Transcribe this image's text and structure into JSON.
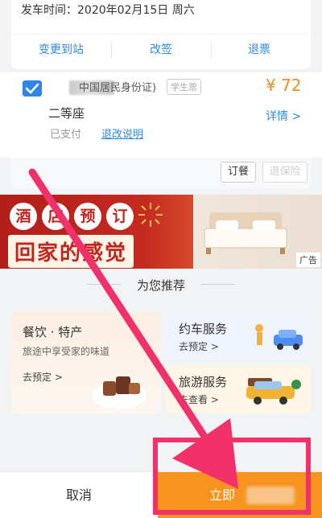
{
  "top_card": {
    "depart_time": "发车时间：2020年02月15日 周六",
    "actions": [
      "变更到站",
      "改签",
      "退票"
    ]
  },
  "passenger": {
    "id_type": "中国居民身份证)",
    "badge": "学生票",
    "price": "¥ 72",
    "seat_class": "二等座",
    "detail_link": "详情 >",
    "paid_status": "已支付",
    "refund_rules": "退改说明"
  },
  "ticket_actions": {
    "order_label": "订餐",
    "insure_label": "退保险"
  },
  "banner": {
    "chars": [
      "酒",
      "店",
      "预",
      "订"
    ],
    "slogan": "回家的感觉",
    "ad_tag": "广告"
  },
  "recommend": {
    "title": "为您推荐",
    "food": {
      "title": "餐饮 · 特产",
      "subtitle": "旅途中享受家的味道",
      "cta": "去预定 >"
    },
    "car": {
      "title": "约车服务",
      "cta": "去预定 >"
    },
    "tour": {
      "title": "旅游服务",
      "cta": "去查看 >"
    }
  },
  "bottom_bar": {
    "cancel_label": "取消",
    "buy_label": "立即"
  },
  "colors": {
    "accent_blue": "#2e8ae6",
    "price_orange": "#f08a24",
    "buy_orange": "#f7931e",
    "annotation_pink": "#f2316b",
    "banner_red": "#c4241c"
  }
}
